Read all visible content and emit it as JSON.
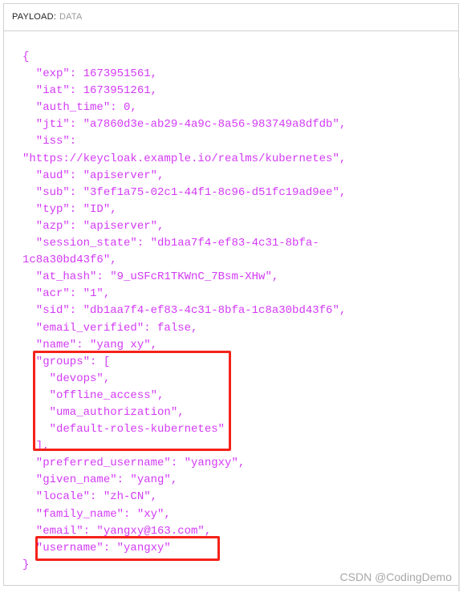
{
  "header": {
    "label": "PAYLOAD:",
    "sublabel": "DATA"
  },
  "colors": {
    "json_text": "#d33af5",
    "highlight_box": "#f5221a"
  },
  "lines": [
    "{",
    "  \"exp\": 1673951561,",
    "  \"iat\": 1673951261,",
    "  \"auth_time\": 0,",
    "  \"jti\": \"a7860d3e-ab29-4a9c-8a56-983749a8dfdb\",",
    "  \"iss\":",
    "\"https://keycloak.example.io/realms/kubernetes\",",
    "  \"aud\": \"apiserver\",",
    "  \"sub\": \"3fef1a75-02c1-44f1-8c96-d51fc19ad9ee\",",
    "  \"typ\": \"ID\",",
    "  \"azp\": \"apiserver\",",
    "  \"session_state\": \"db1aa7f4-ef83-4c31-8bfa-",
    "1c8a30bd43f6\",",
    "  \"at_hash\": \"9_uSFcR1TKWnC_7Bsm-XHw\",",
    "  \"acr\": \"1\",",
    "  \"sid\": \"db1aa7f4-ef83-4c31-8bfa-1c8a30bd43f6\",",
    "  \"email_verified\": false,",
    "  \"name\": \"yang xy\",",
    "  \"groups\": [",
    "    \"devops\",",
    "    \"offline_access\",",
    "    \"uma_authorization\",",
    "    \"default-roles-kubernetes\"",
    "  ],",
    "  \"preferred_username\": \"yangxy\",",
    "  \"given_name\": \"yang\",",
    "  \"locale\": \"zh-CN\",",
    "  \"family_name\": \"xy\",",
    "  \"email\": \"yangxy@163.com\",",
    "  \"username\": \"yangxy\"",
    "}"
  ],
  "watermark": "CSDN @CodingDemo"
}
